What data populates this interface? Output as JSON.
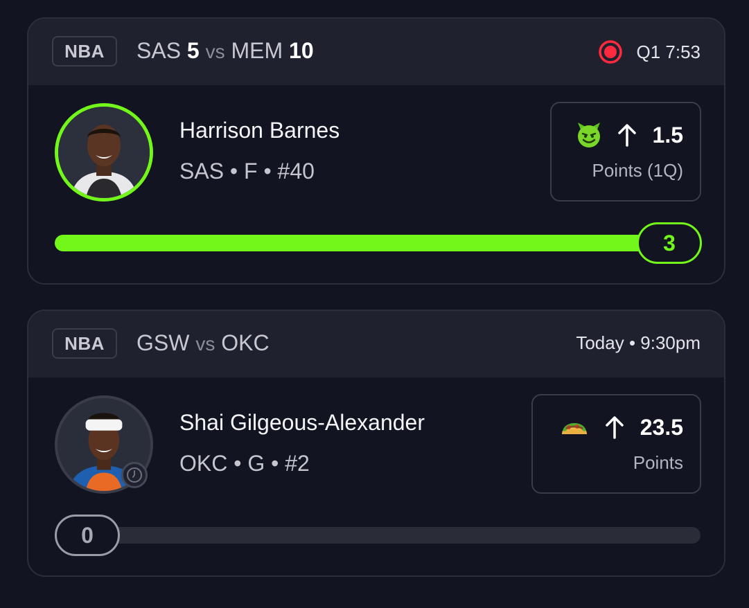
{
  "cards": [
    {
      "league": "NBA",
      "matchup": {
        "team1": "SAS",
        "score1": "5",
        "vs": "vs",
        "team2": "MEM",
        "score2": "10"
      },
      "status": {
        "icon": "live-record-icon",
        "text": "Q1 7:53",
        "color": "#ff2a3d"
      },
      "player": {
        "name": "Harrison Barnes",
        "meta": "SAS • F • #40"
      },
      "prop": {
        "emoji": "smiling-devil-emoji",
        "direction": "up-arrow-icon",
        "line": "1.5",
        "label": "Points (1Q)"
      },
      "progress": {
        "value": "3",
        "fraction": 1.0,
        "color": "#73f71a"
      }
    },
    {
      "league": "NBA",
      "matchup": {
        "team1": "GSW",
        "vs": "vs",
        "team2": "OKC"
      },
      "status": {
        "text": "Today • 9:30pm"
      },
      "player": {
        "name": "Shai Gilgeous-Alexander",
        "meta": "OKC • G • #2",
        "badge_icon": "clock-icon"
      },
      "prop": {
        "emoji": "taco-emoji",
        "direction": "up-arrow-icon",
        "line": "23.5",
        "label": "Points"
      },
      "progress": {
        "value": "0",
        "fraction": 0.0,
        "color": "#9a9ca6"
      }
    }
  ]
}
